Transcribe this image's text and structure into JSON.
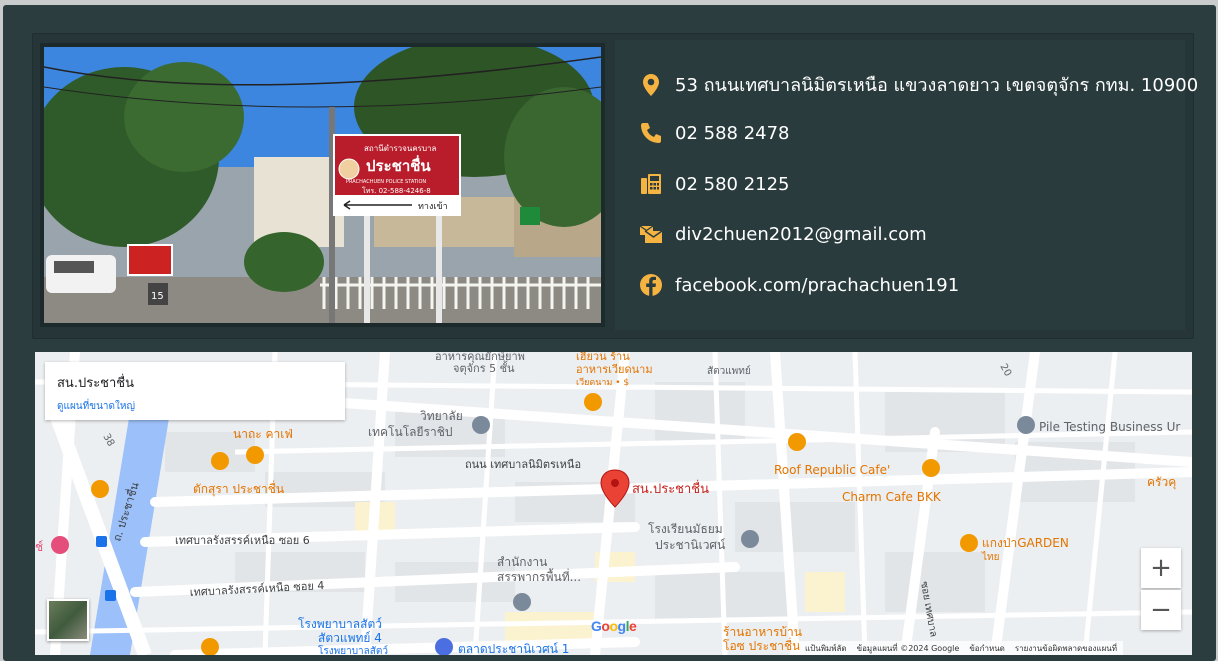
{
  "contact": {
    "address": "53 ถนนเทศบาลนิมิตรเหนือ แขวงลาดยาว เขตจตุจักร กทม. 10900",
    "phone": "02 588 2478",
    "fax": "02 580 2125",
    "email": "div2chuen2012@gmail.com",
    "facebook": "facebook.com/prachachuen191",
    "icon_color": "#f5b342"
  },
  "photo": {
    "sign_title": "สถานีตำรวจนครบาล",
    "sign_name": "ประชาชื่น",
    "sign_en": "PRACHACHUEN POLICE STATION",
    "sign_phone": "โทร. 02-588-4246-8",
    "sign_entry": "ทางเข้า",
    "street_sign": "15"
  },
  "map": {
    "place_name": "สน.ประชาชื่น",
    "view_larger": "ดูแผนที่ขนาดใหญ่",
    "marker_label": "สน.ประชาชื่น",
    "zoom_in": "+",
    "zoom_out": "−",
    "google": "Google",
    "attribution": {
      "shortcuts": "แป้นพิมพ์ลัด",
      "data": "ข้อมูลแผนที่ ©2024 Google",
      "terms": "ข้อกำหนด",
      "report": "รายงานข้อผิดพลาดของแผนที่"
    },
    "labels": {
      "road_main": "ถนน เทศบาลนิมิตรเหนือ",
      "college_1": "วิทยาลัย",
      "college_2": "เทคโนโลยีราชิป",
      "nata": "นาถะ คาเฟ่",
      "taksura": "ตักสุรา ประชาชื่น",
      "roof": "Roof Republic Cafe'",
      "charm": "Charm Cafe BKK",
      "pile": "Pile Testing Business Ur",
      "school_1": "โรงเรียนมัธยม",
      "school_2": "ประชานิเวศน์",
      "soi6": "เทศบาลรังสรรค์เหนือ ซอย 6",
      "soi4": "เทศบาลรังสรรค์เหนือ ซอย 4",
      "revenue_1": "สำนักงาน",
      "revenue_2": "สรรพากรพื้นที่...",
      "vet_1": "โรงพยาบาลสัตว์",
      "vet_2": "สัตวแพทย์ 4",
      "vet_3": "โรงพยาบาลสัตว์",
      "market": "ตลาดประชานิเวศน์ 1",
      "kaengpa": "แกงป่าGARDEN",
      "thai": "ไทย",
      "restaurant_1": "ร้านอาหารบ้าน",
      "restaurant_2": "โอซ ประชาชื่น",
      "prachachuen_road": "ถ. ประชาชื่น",
      "krua": "ครัวคุ",
      "top_food_1": "อาหารคุณยักษ์ยาพ",
      "top_food_2": "จตุจักร 5 ชั้น",
      "top_viet_1": "เฮียวน ร้าน",
      "top_viet_2": "อาหารเวียดนาม",
      "top_viet_3": "เวียดนาม • $",
      "vet_top": "สัตวแพทย์",
      "soi_vert": "ซอย เทศบาล",
      "num38": "38",
      "num20": "20",
      "left_cut": "ช์"
    }
  }
}
